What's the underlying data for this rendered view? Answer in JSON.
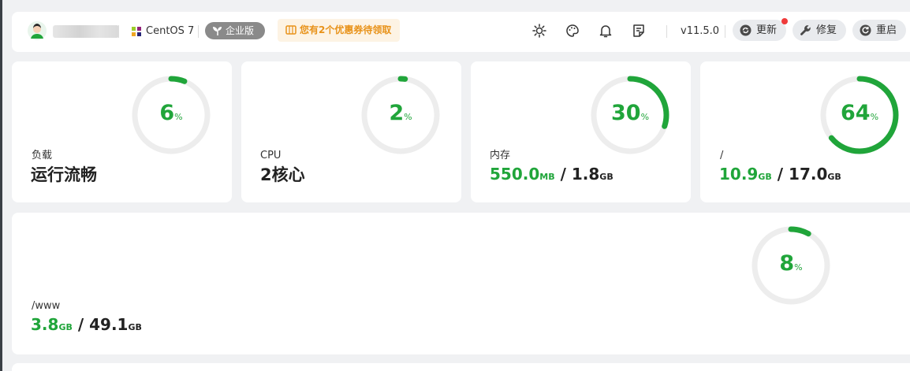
{
  "header": {
    "os_name": "CentOS 7",
    "edition_badge": "企业版",
    "coupon_text": "您有2个优惠券待领取",
    "version": "v11.5.0",
    "buttons": {
      "update": "更新",
      "repair": "修复",
      "restart": "重启"
    },
    "icons": [
      "sun-icon",
      "palette-icon",
      "bell-icon",
      "notes-icon"
    ]
  },
  "cards": {
    "load": {
      "label": "负载",
      "status": "运行流畅",
      "percent": "6",
      "pct_sign": "%",
      "fraction": 0.06
    },
    "cpu": {
      "label": "CPU",
      "status": "2核心",
      "percent": "2",
      "pct_sign": "%",
      "fraction": 0.02
    },
    "memory": {
      "label": "内存",
      "used": "550.0",
      "used_unit": "MB",
      "separator": "/",
      "total": "1.8",
      "total_unit": "GB",
      "percent": "30",
      "pct_sign": "%",
      "fraction": 0.3
    },
    "disk_root": {
      "label": "/",
      "used": "10.9",
      "used_unit": "GB",
      "separator": "/",
      "total": "17.0",
      "total_unit": "GB",
      "percent": "64",
      "pct_sign": "%",
      "fraction": 0.64
    },
    "disk_www": {
      "label": "/www",
      "used": "3.8",
      "used_unit": "GB",
      "separator": "/",
      "total": "49.1",
      "total_unit": "GB",
      "percent": "8",
      "pct_sign": "%",
      "fraction": 0.08
    }
  },
  "colors": {
    "accent_green": "#20a53a",
    "ring_track": "#ededed",
    "coupon_orange": "#e89219",
    "badge_gray": "#8a8a8a",
    "update_dot": "#ef3b3b"
  }
}
